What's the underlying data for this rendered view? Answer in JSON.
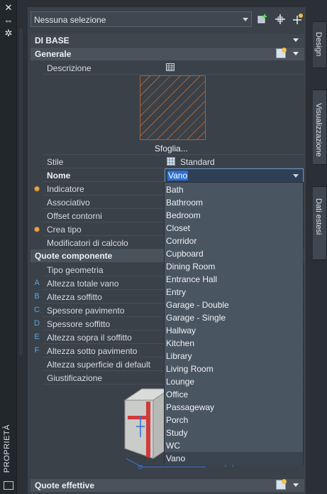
{
  "palette": {
    "panel_bg": "#3a4149",
    "section_bg": "#4a525b",
    "dropdown_bg": "#4a5562",
    "selection_blue": "#2d6fd1",
    "hatch_orange": "#b25f28",
    "indicator_orange": "#f2a43a",
    "letter_blue": "#5aa6e6"
  },
  "window": {
    "vertical_title": "PROPRIETÀ",
    "close_icon": "close-icon",
    "autohide_icon": "autohide-icon",
    "settings_icon": "gear-icon"
  },
  "selector": {
    "value": "Nessuna selezione",
    "icons": [
      "quick-select-icon",
      "pick-objects-icon",
      "toggle-pickadd-icon"
    ]
  },
  "sections": {
    "base": {
      "title": "DI BASE"
    },
    "general": {
      "title": "Generale",
      "properties": {
        "description": "Descrizione",
        "browse": "Sfoglia...",
        "style_label": "Stile",
        "style_value": "Standard",
        "name_label": "Nome",
        "name_value": "Vano",
        "indicator": "Indicatore",
        "associative": "Associativo",
        "offset": "Offset contorni",
        "create_type": "Crea tipo",
        "calc_mod": "Modificatori di calcolo"
      }
    },
    "components": {
      "title": "Quote componente",
      "rows": [
        {
          "mark": "",
          "label": "Tipo geometria"
        },
        {
          "mark": "A",
          "label": "Altezza totale vano"
        },
        {
          "mark": "B",
          "label": "Altezza soffitto"
        },
        {
          "mark": "C",
          "label": "Spessore pavimento"
        },
        {
          "mark": "D",
          "label": "Spessore soffitto"
        },
        {
          "mark": "E",
          "label": "Altezza sopra il soffitto"
        },
        {
          "mark": "F",
          "label": "Altezza sotto pavimento"
        },
        {
          "mark": "",
          "label": "Altezza superficie di default"
        },
        {
          "mark": "",
          "label": "Giustificazione"
        }
      ]
    },
    "effective": {
      "title": "Quote effettive"
    }
  },
  "dropdown": {
    "selected": "Vano",
    "options": [
      "Bath",
      "Bathroom",
      "Bedroom",
      "Closet",
      "Corridor",
      "Cupboard",
      "Dining Room",
      "Entrance Hall",
      "Entry",
      "Garage - Double",
      "Garage - Single",
      "Hallway",
      "Kitchen",
      "Library",
      "Living Room",
      "Lounge",
      "Office",
      "Passageway",
      "Porch",
      "Study",
      "WC",
      "Vano"
    ]
  },
  "tabs": [
    {
      "label": "Design",
      "active": true
    },
    {
      "label": "Visualizzazione",
      "active": false
    },
    {
      "label": "Dati estesi",
      "active": false
    }
  ]
}
